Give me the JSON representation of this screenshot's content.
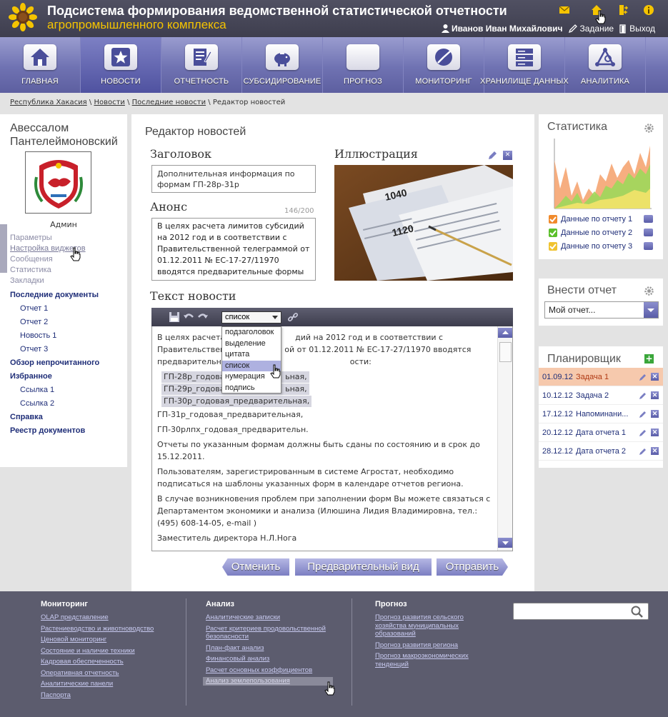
{
  "header": {
    "title": "Подсистема формирования ведомственной статистической отчетности",
    "subtitle": "агропромышленного комплекса",
    "user_name": "Иванов Иван Михайлович",
    "task_label": "Задание",
    "logout_label": "Выход",
    "colors": {
      "bg": "#46465a",
      "subtitle": "#f5c400"
    }
  },
  "nav": {
    "items": [
      {
        "label": "ГЛАВНАЯ",
        "icon": "house-icon"
      },
      {
        "label": "НОВОСТИ",
        "icon": "star-icon",
        "active": true
      },
      {
        "label": "ОТЧЕТНОСТЬ",
        "icon": "document-pen-icon"
      },
      {
        "label": "СУБСИДИРОВАНИЕ",
        "icon": "piggy-bank-icon"
      },
      {
        "label": "ПРОГНОЗ",
        "icon": "blank-icon"
      },
      {
        "label": "МОНИТОРИНГ",
        "icon": "pie-chart-icon"
      },
      {
        "label": "ХРАНИЛИЩЕ ДАННЫХ",
        "icon": "server-icon"
      },
      {
        "label": "АНАЛИТИКА",
        "icon": "molecule-icon"
      }
    ]
  },
  "breadcrumb": {
    "items": [
      "Республика Хакасия",
      "Новости",
      "Последние новости"
    ],
    "current": "Редактор новостей"
  },
  "left": {
    "name": "Авессалом Пантелеймоновский",
    "role": "Админ",
    "menu": [
      "Параметры",
      "Настройка виджетов",
      "Сообщения",
      "Статистика",
      "Закладки"
    ],
    "sections": {
      "recent_docs": "Последние документы",
      "recent_items": [
        "Отчет 1",
        "Отчет 2",
        "Новость 1",
        "Отчет 3"
      ],
      "unread": "Обзор непрочитанного",
      "favorites": "Избранное",
      "fav_items": [
        "Ссылка 1",
        "Ссылка 2"
      ],
      "help": "Справка",
      "registry": "Реестр документов"
    }
  },
  "editor": {
    "title": "Редактор новостей",
    "heading_label": "Заголовок",
    "heading_value": "Дополнительная информация по формам ГП-28р-31р",
    "illustration_label": "Иллюстрация",
    "announce_label": "Анонс",
    "announce_counter": "146/200",
    "announce_value": "В целях расчета лимитов субсидий на 2012 год и в соответствии с Правительственной телеграммой от 01.12.2011 № ЕС-17-27/11970 вводятся предварительные формы отчетности",
    "text_label": "Текст новости",
    "style_select": "список",
    "dropdown_options": [
      "подзаголовок",
      "выделение",
      "цитата",
      "список",
      "нумерация",
      "подпись"
    ],
    "body": {
      "p1a": "В целях расчета",
      "p1b": "дий на 2012 год и в соответствии с",
      "p2a": "Правительствен",
      "p2b": "ой от 01.12.2011 № ЕС-17-27/11970 вводятся",
      "p3a": "предварительн",
      "p3b": "ости:",
      "chip1a": "ГП-28р_годовая",
      "chip1b": "ьная,",
      "chip2a": "ГП-29р_годовая",
      "chip2b": "ьная,",
      "chip3": "ГП-30р_годовая_предварительная,",
      "line4": "ГП-31р_годовая_предварительная,",
      "line5": "ГП-30рлпх_годовая_предварительн.",
      "para6": "Отчеты по указанным формам должны быть сданы по состоянию и в срок до 15.12.2011.",
      "para7": "Пользователям, зарегистрированным в системе Агростат, необходимо подписаться на шаблоны указанных форм в календаре отчетов региона.",
      "para8": "В случае возникновения проблем при заполнении форм Вы можете связаться с Департаментом экономики и анализа (Илюшина Лидия Владимировна, тел.: (495) 608-14-05, e-mail )",
      "para9": "Заместитель директора Н.Л.Нога"
    },
    "buttons": {
      "cancel": "Отменить",
      "preview": "Предварительный вид",
      "send": "Отправить"
    }
  },
  "stats": {
    "title": "Статистика",
    "legend": [
      {
        "label": "Данные по отчету 1",
        "color": "#f08a2c"
      },
      {
        "label": "Данные по отчету 2",
        "color": "#5bbf2a"
      },
      {
        "label": "Данные по отчету 3",
        "color": "#f0c330"
      }
    ]
  },
  "report": {
    "title": "Внести отчет",
    "select": "Мой отчет..."
  },
  "planner": {
    "title": "Планировщик",
    "rows": [
      {
        "date": "01.09.12",
        "task": "Задача 1"
      },
      {
        "date": "10.12.12",
        "task": "Задача 2"
      },
      {
        "date": "17.12.12",
        "task": "Напоминани..."
      },
      {
        "date": "20.12.12",
        "task": "Дата отчета 1"
      },
      {
        "date": "28.12.12",
        "task": "Дата отчета 2"
      }
    ]
  },
  "footer": {
    "monitoring": {
      "title": "Мониторинг",
      "links": [
        "OLAP представление",
        "Растениеводство и животноводство",
        "Ценовой мониторинг",
        "Состояние и наличие техники",
        "Кадровая обеспеченность",
        "Оперативная отчетность",
        "Аналитические панели",
        "Паспорта"
      ]
    },
    "analysis": {
      "title": "Анализ",
      "links": [
        "Аналитические записки",
        "Расчет критериев продовольственной безопасности",
        "План-факт анализ",
        "Финансовый анализ",
        "Расчет основных коэффициентов",
        "Анализ землепользования"
      ]
    },
    "forecast": {
      "title": "Прогноз",
      "links": [
        "Прогноз развития сельского хозяйства муниципальных образований",
        "Прогноз развития региона",
        "Прогноз макроэкономических тенденций"
      ]
    }
  }
}
